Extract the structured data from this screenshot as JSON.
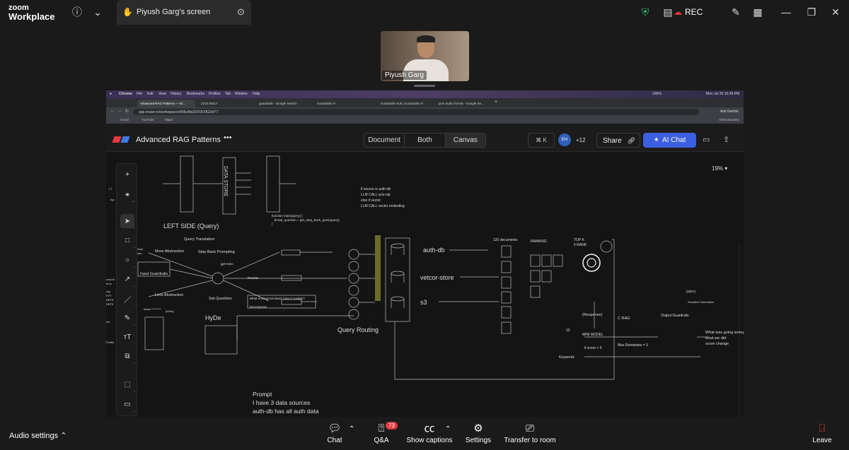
{
  "zoom": {
    "brand_line1": "zoom",
    "brand_line2": "Workplace",
    "tab_title": "Piyush Garg's screen",
    "rec_label": "REC"
  },
  "participant": {
    "name": "Piyush Garg"
  },
  "mac_menu": [
    "Chrome",
    "File",
    "Edit",
    "View",
    "History",
    "Bookmarks",
    "Profiles",
    "Tab",
    "Window",
    "Help"
  ],
  "mac_status": {
    "battery": "100%",
    "datetime": "Mon Jul 20  10:36 PM"
  },
  "chrome_tabs": [
    "Advanced RAG Patterns — Er...",
    "2310.06117",
    "guardrails - Google Search",
    "Guardrails AI",
    "Guardrails Hub | Guardrails AI",
    "pcm audio format - Google Se..."
  ],
  "chrome": {
    "url": "app.eraser.io/workspace/v806uf0pZ0X1KXKZzkY7",
    "ask_gemini": "Ask Gemini",
    "bookmarks": [
      "Gmail",
      "YouTube",
      "Maps"
    ],
    "all_bookmarks": "All Bookmarks"
  },
  "eraser": {
    "title": "Advanced RAG Patterns",
    "views": [
      "Document",
      "Both",
      "Canvas"
    ],
    "active_view": "Canvas",
    "shortcut": "⌘ K",
    "avatar": "EH",
    "extra_users": "+12",
    "share": "Share",
    "ai_chat": "AI Chat",
    "zoom_level": "19%"
  },
  "tools": [
    {
      "icon": "+",
      "key": ""
    },
    {
      "icon": "⚹",
      "key": "M J"
    },
    {
      "icon": "➤",
      "key": "V"
    },
    {
      "icon": "□",
      "key": "R"
    },
    {
      "icon": "○",
      "key": "O"
    },
    {
      "icon": "↗",
      "key": "A"
    },
    {
      "icon": "／",
      "key": "L"
    },
    {
      "icon": "✎",
      "key": "P"
    },
    {
      "icon": "тT",
      "key": "T"
    },
    {
      "icon": "⧉",
      "key": "S"
    },
    {
      "icon": "⬚",
      "key": "F"
    },
    {
      "icon": "▭",
      "key": "C"
    }
  ],
  "canvas_text": {
    "data_store": "DATA STORE",
    "left_side": "LEFT SIDE (Query)",
    "query_translation": "Query Translation",
    "more_abstraction": "More Abstraction",
    "step_back": "Step Back Prompting",
    "gpt_nano": "gpt-nano",
    "input_guardrails": "Input Guardrails",
    "rewrite": "Rewrite",
    "less_abstraction": "Less Abstraction",
    "sub_questions": "Sub Questions",
    "temporal": "What is temporal dead zone in nodejs?",
    "decompose": "Decompose",
    "hyde": "HyDe",
    "query_routing": "Query Routing",
    "mask": "Mask *********",
    "id3rn_left": "{id3rn}",
    "code_main": [
      "function main(query) {",
      "   broad_question = get_step_back_ques(query)",
      "}"
    ],
    "llm_logic": [
      "if source is auth-db",
      "LLM CALL q-to-sql",
      "else if vector",
      "LLM CALL vector embeding"
    ],
    "auth_db": "auth-db",
    "vector_store": "vetcor-store",
    "s3": "s3",
    "docs_120": "120 documents",
    "ranking": "RANKING",
    "topk": [
      "TOP K",
      "5 RANK"
    ],
    "id3rn_right": "{id3rn}",
    "sensitive": "Sensitive Information",
    "response": "(Response)",
    "c_rag": "C RAG",
    "output_guardrails": "Output Guardrails",
    "ten": "10",
    "mini_model": "MINI MODEL",
    "score": "if score < 6",
    "max_retries": "Max Retreiwtes = 3",
    "keywords": "Keywords",
    "right_notes": [
      "What was going wrong",
      "what we did",
      "score change"
    ],
    "prompt": [
      "Prompt",
      "I have 3 data sources",
      "auth-db has all auth data"
    ],
    "left_edge": [
      "{ }",
      "top",
      "ricks",
      "oss",
      "umb to",
      "nt to",
      "cky",
      "HTT",
      "DETE",
      "DETE",
      "ion",
      "Profile"
    ]
  },
  "bottom": {
    "audio": "Audio settings",
    "chat": "Chat",
    "qa": "Q&A",
    "qa_badge": "73",
    "captions": "Show captions",
    "settings": "Settings",
    "transfer": "Transfer to room",
    "leave": "Leave"
  },
  "colors": {
    "accent": "#3b5fe0",
    "rec_red": "#e0393e",
    "shield_green": "#2fbf71",
    "router_bar": "#6a6a2a"
  }
}
